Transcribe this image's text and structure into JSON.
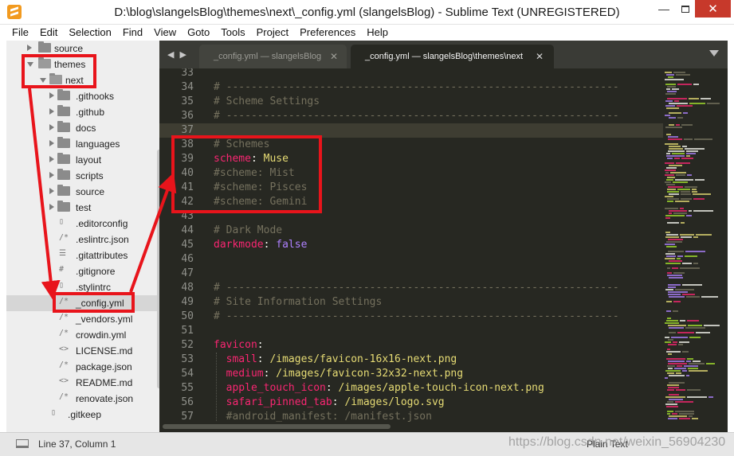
{
  "window": {
    "title": "D:\\blog\\slangelsBlog\\themes\\next\\_config.yml (slangelsBlog) - Sublime Text (UNREGISTERED)",
    "min_glyph": "—",
    "close_glyph": "✕"
  },
  "menu": [
    "File",
    "Edit",
    "Selection",
    "Find",
    "View",
    "Goto",
    "Tools",
    "Project",
    "Preferences",
    "Help"
  ],
  "sidebar": {
    "items": [
      {
        "label": "source",
        "type": "folder",
        "level": 1,
        "expanded": false,
        "icon": "folder-icon"
      },
      {
        "label": "themes",
        "type": "folder",
        "level": 1,
        "expanded": true,
        "icon": "folder-open-icon"
      },
      {
        "label": "next",
        "type": "folder",
        "level": 2,
        "expanded": true,
        "icon": "folder-open-icon"
      },
      {
        "label": ".githooks",
        "type": "folder",
        "level": 3,
        "expanded": false,
        "icon": "folder-icon"
      },
      {
        "label": ".github",
        "type": "folder",
        "level": 3,
        "expanded": false,
        "icon": "folder-icon"
      },
      {
        "label": "docs",
        "type": "folder",
        "level": 3,
        "expanded": false,
        "icon": "folder-icon"
      },
      {
        "label": "languages",
        "type": "folder",
        "level": 3,
        "expanded": false,
        "icon": "folder-icon"
      },
      {
        "label": "layout",
        "type": "folder",
        "level": 3,
        "expanded": false,
        "icon": "folder-icon"
      },
      {
        "label": "scripts",
        "type": "folder",
        "level": 3,
        "expanded": false,
        "icon": "folder-icon"
      },
      {
        "label": "source",
        "type": "folder",
        "level": 3,
        "expanded": false,
        "icon": "folder-icon"
      },
      {
        "label": "test",
        "type": "folder",
        "level": 3,
        "expanded": false,
        "icon": "folder-icon"
      },
      {
        "label": ".editorconfig",
        "type": "file",
        "level": 3,
        "glyph": "▯",
        "icon": "file-icon"
      },
      {
        "label": ".eslintrc.json",
        "type": "file",
        "level": 3,
        "glyph": "/*",
        "icon": "comment-file-icon"
      },
      {
        "label": ".gitattributes",
        "type": "file",
        "level": 3,
        "glyph": "☰",
        "icon": "text-file-icon"
      },
      {
        "label": ".gitignore",
        "type": "file",
        "level": 3,
        "glyph": "#",
        "icon": "hash-file-icon"
      },
      {
        "label": ".stylintrc",
        "type": "file",
        "level": 3,
        "glyph": "▯",
        "icon": "file-icon"
      },
      {
        "label": "_config.yml",
        "type": "file",
        "level": 3,
        "glyph": "/*",
        "icon": "comment-file-icon",
        "selected": true
      },
      {
        "label": "_vendors.yml",
        "type": "file",
        "level": 3,
        "glyph": "/*",
        "icon": "comment-file-icon"
      },
      {
        "label": "crowdin.yml",
        "type": "file",
        "level": 3,
        "glyph": "/*",
        "icon": "comment-file-icon"
      },
      {
        "label": "LICENSE.md",
        "type": "file",
        "level": 3,
        "glyph": "<>",
        "icon": "markup-file-icon"
      },
      {
        "label": "package.json",
        "type": "file",
        "level": 3,
        "glyph": "/*",
        "icon": "comment-file-icon"
      },
      {
        "label": "README.md",
        "type": "file",
        "level": 3,
        "glyph": "<>",
        "icon": "markup-file-icon"
      },
      {
        "label": "renovate.json",
        "type": "file",
        "level": 3,
        "glyph": "/*",
        "icon": "comment-file-icon"
      },
      {
        "label": ".gitkeep",
        "type": "file",
        "level": 2,
        "glyph": "▯",
        "icon": "file-icon"
      }
    ]
  },
  "tabs": {
    "nav": "◀ ▶",
    "items": [
      {
        "label": "_config.yml — slangelsBlog",
        "active": false
      },
      {
        "label": "_config.yml — slangelsBlog\\themes\\next",
        "active": true
      }
    ],
    "close_glyph": "✕"
  },
  "editor": {
    "lines": [
      {
        "n": "33",
        "tokens": []
      },
      {
        "n": "34",
        "tokens": [
          {
            "t": "# ---------------------------------------------------------------",
            "c": "comment"
          }
        ]
      },
      {
        "n": "35",
        "tokens": [
          {
            "t": "# Scheme Settings",
            "c": "comment"
          }
        ]
      },
      {
        "n": "36",
        "tokens": [
          {
            "t": "# ---------------------------------------------------------------",
            "c": "comment"
          }
        ]
      },
      {
        "n": "37",
        "tokens": [],
        "current": true
      },
      {
        "n": "38",
        "tokens": [
          {
            "t": "# Schemes",
            "c": "comment"
          }
        ]
      },
      {
        "n": "39",
        "tokens": [
          {
            "t": "scheme",
            "c": "key"
          },
          {
            "t": ": ",
            "c": "plain"
          },
          {
            "t": "Muse",
            "c": "str"
          }
        ]
      },
      {
        "n": "40",
        "tokens": [
          {
            "t": "#scheme: Mist",
            "c": "comment"
          }
        ]
      },
      {
        "n": "41",
        "tokens": [
          {
            "t": "#scheme: Pisces",
            "c": "comment"
          }
        ]
      },
      {
        "n": "42",
        "tokens": [
          {
            "t": "#scheme: Gemini",
            "c": "comment"
          }
        ]
      },
      {
        "n": "43",
        "tokens": []
      },
      {
        "n": "44",
        "tokens": [
          {
            "t": "# Dark Mode",
            "c": "comment"
          }
        ]
      },
      {
        "n": "45",
        "tokens": [
          {
            "t": "darkmode",
            "c": "key"
          },
          {
            "t": ": ",
            "c": "plain"
          },
          {
            "t": "false",
            "c": "bool"
          }
        ]
      },
      {
        "n": "46",
        "tokens": []
      },
      {
        "n": "47",
        "tokens": []
      },
      {
        "n": "48",
        "tokens": [
          {
            "t": "# ---------------------------------------------------------------",
            "c": "comment"
          }
        ]
      },
      {
        "n": "49",
        "tokens": [
          {
            "t": "# Site Information Settings",
            "c": "comment"
          }
        ]
      },
      {
        "n": "50",
        "tokens": [
          {
            "t": "# ---------------------------------------------------------------",
            "c": "comment"
          }
        ]
      },
      {
        "n": "51",
        "tokens": []
      },
      {
        "n": "52",
        "tokens": [
          {
            "t": "favicon",
            "c": "key"
          },
          {
            "t": ":",
            "c": "plain"
          }
        ]
      },
      {
        "n": "53",
        "tokens": [
          {
            "t": "  small",
            "c": "key"
          },
          {
            "t": ": ",
            "c": "plain"
          },
          {
            "t": "/images/favicon-16x16-next.png",
            "c": "str"
          }
        ]
      },
      {
        "n": "54",
        "tokens": [
          {
            "t": "  medium",
            "c": "key"
          },
          {
            "t": ": ",
            "c": "plain"
          },
          {
            "t": "/images/favicon-32x32-next.png",
            "c": "str"
          }
        ]
      },
      {
        "n": "55",
        "tokens": [
          {
            "t": "  apple_touch_icon",
            "c": "key"
          },
          {
            "t": ": ",
            "c": "plain"
          },
          {
            "t": "/images/apple-touch-icon-next.png",
            "c": "str"
          }
        ]
      },
      {
        "n": "56",
        "tokens": [
          {
            "t": "  safari_pinned_tab",
            "c": "key"
          },
          {
            "t": ": ",
            "c": "plain"
          },
          {
            "t": "/images/logo.svg",
            "c": "str"
          }
        ]
      },
      {
        "n": "57",
        "tokens": [
          {
            "t": "  #android_manifest: /manifest.json",
            "c": "comment"
          }
        ]
      }
    ]
  },
  "status": {
    "position": "Line 37, Column 1",
    "syntax": "Plain Text"
  },
  "watermark": "https://blog.csdn.net/weixin_56904230",
  "colors": {
    "annotation": "#e8141b",
    "editor_bg": "#272822",
    "comment": "#75715e",
    "key": "#f92672",
    "string": "#e6db74",
    "boolean": "#ae81ff"
  }
}
